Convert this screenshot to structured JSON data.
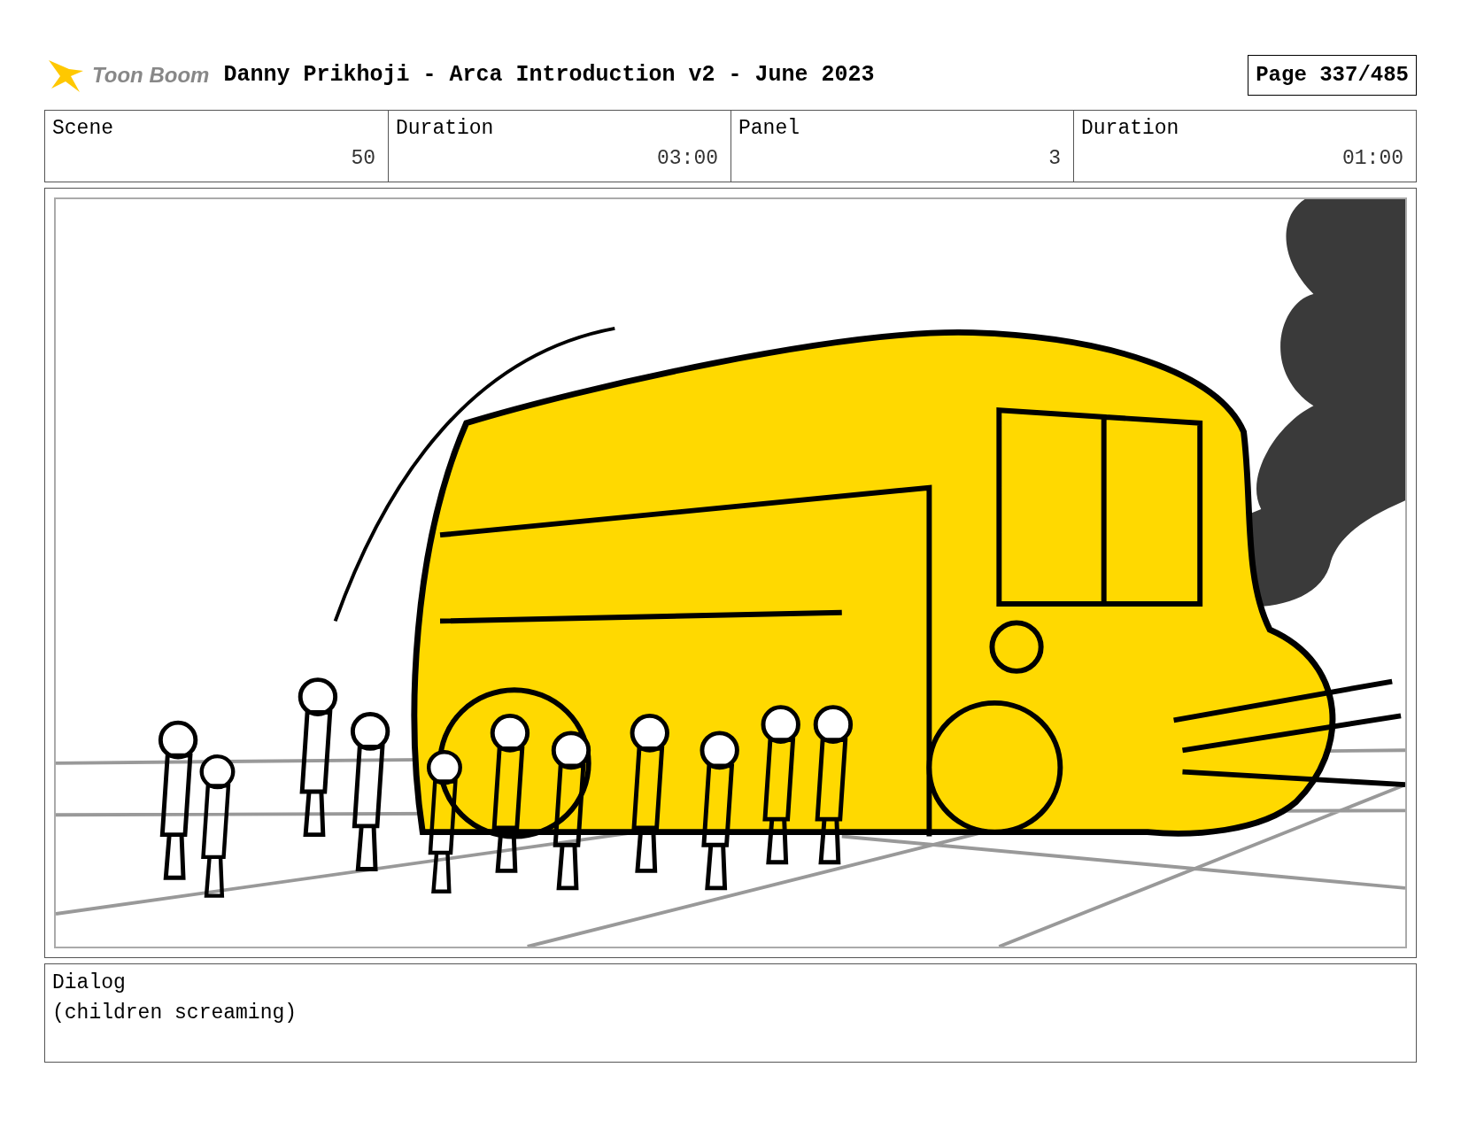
{
  "header": {
    "logo_text": "Toon Boom",
    "title": "Danny Prikhoji - Arca Introduction v2 - June 2023",
    "page": "Page 337/485"
  },
  "fields": [
    {
      "label": "Scene",
      "value": "50"
    },
    {
      "label": "Duration",
      "value": "03:00"
    },
    {
      "label": "Panel",
      "value": "3"
    },
    {
      "label": "Duration",
      "value": "01:00"
    }
  ],
  "dialog": {
    "label": "Dialog",
    "text": "(children screaming)"
  }
}
